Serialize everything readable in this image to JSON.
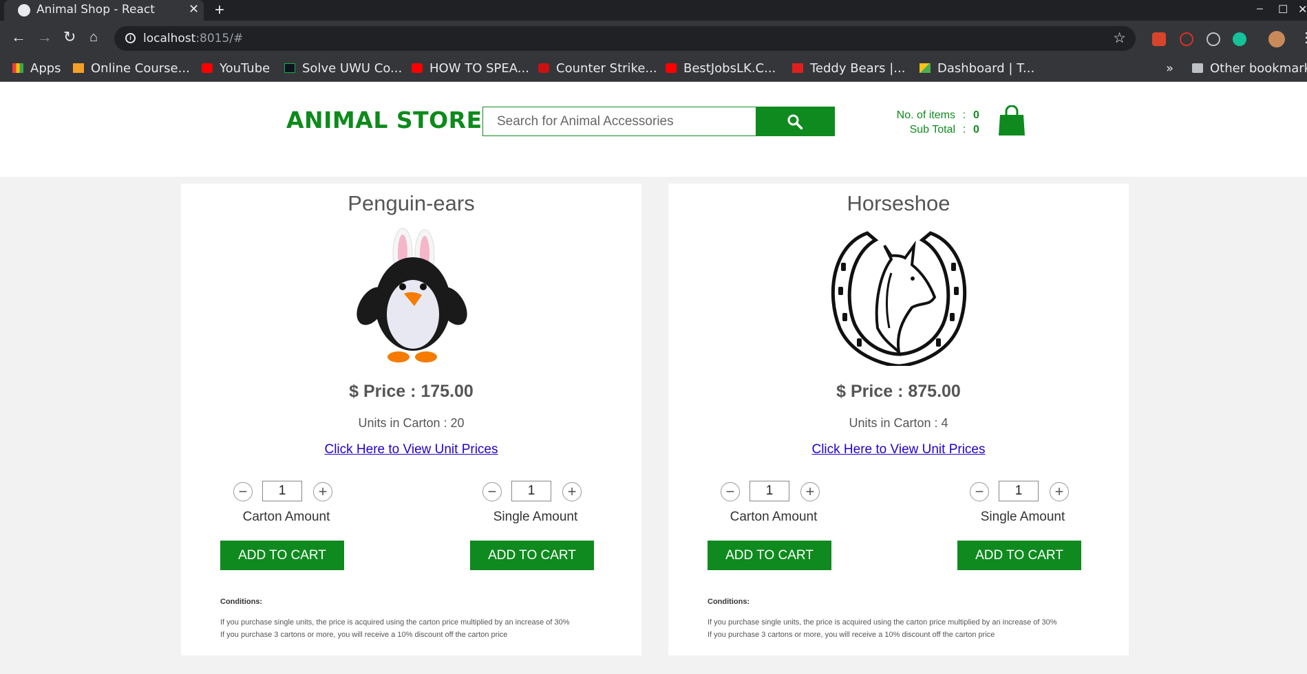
{
  "browser": {
    "tab_title": "Animal Shop - React",
    "url_host": "localhost",
    "url_rest": ":8015/#",
    "bookmarks": [
      {
        "label": "Apps",
        "color": "#e94235"
      },
      {
        "label": "Online Course...",
        "color": "#f4a028"
      },
      {
        "label": "YouTube",
        "color": "#ff0000"
      },
      {
        "label": "Solve UWU Co...",
        "color": "#1ba94c"
      },
      {
        "label": "HOW TO SPEA...",
        "color": "#ff0000"
      },
      {
        "label": "Counter Strike...",
        "color": "#cc1111"
      },
      {
        "label": "BestJobsLK.C...",
        "color": "#ff0000"
      },
      {
        "label": "Teddy Bears |...",
        "color": "#e02020"
      },
      {
        "label": "Dashboard | T...",
        "color": "#f5c518"
      }
    ],
    "more": "»",
    "other_bookmarks": "Other bookmarks"
  },
  "header": {
    "logo": "ANIMAL STORE",
    "search_placeholder": "Search for Animal Accessories",
    "items_label": "No. of items",
    "items_value": "0",
    "subtotal_label": "Sub Total",
    "subtotal_value": "0",
    "colon": ":"
  },
  "products": [
    {
      "name": "Penguin-ears",
      "price": "$ Price : 175.00",
      "units": "Units in Carton : 20",
      "link": "Click Here to View Unit Prices",
      "carton_qty": "1",
      "single_qty": "1",
      "carton_label": "Carton Amount",
      "single_label": "Single Amount",
      "add_label": "ADD TO CART",
      "conditions_title": "Conditions:",
      "condition_1": "If you purchase single units, the price is acquired using the carton price multiplied by an increase of 30%",
      "condition_2": "If you purchase 3 cartons or more, you will receive a 10% discount off the carton price"
    },
    {
      "name": "Horseshoe",
      "price": "$ Price : 875.00",
      "units": "Units in Carton : 4",
      "link": "Click Here to View Unit Prices",
      "carton_qty": "1",
      "single_qty": "1",
      "carton_label": "Carton Amount",
      "single_label": "Single Amount",
      "add_label": "ADD TO CART",
      "conditions_title": "Conditions:",
      "condition_1": "If you purchase single units, the price is acquired using the carton price multiplied by an increase of 30%",
      "condition_2": "If you purchase 3 cartons or more, you will receive a 10% discount off the carton price"
    }
  ],
  "colors": {
    "brand_green": "#0f8a1e",
    "link": "#2200cc"
  }
}
